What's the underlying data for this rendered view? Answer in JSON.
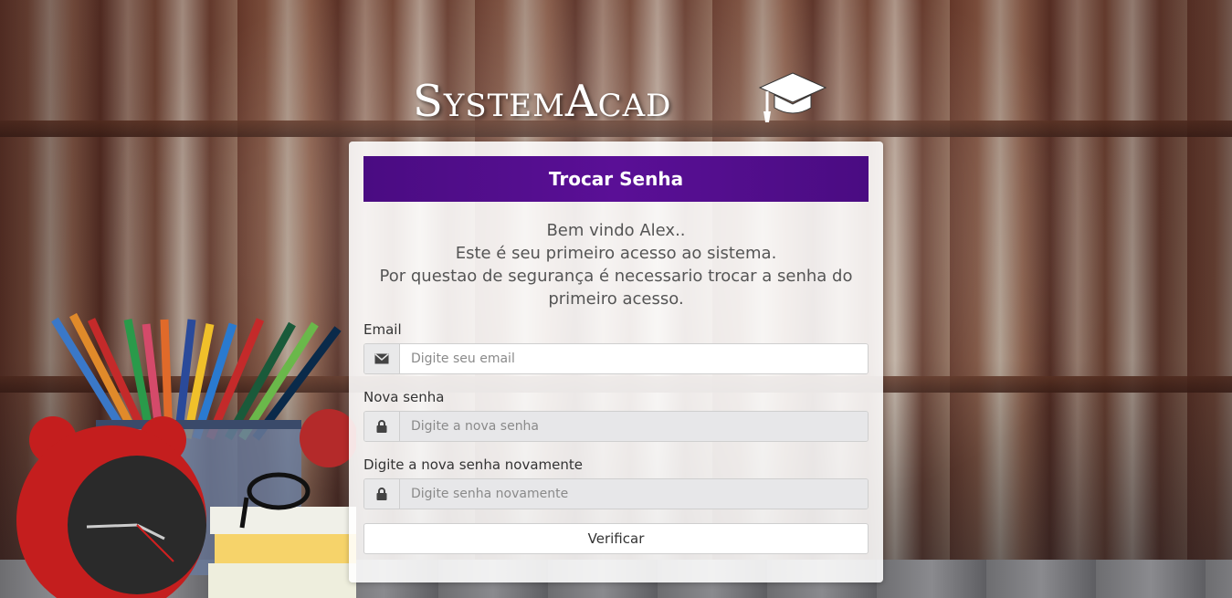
{
  "brand": {
    "name": "SystemAcad",
    "logo_icon": "graduation-cap-icon"
  },
  "card": {
    "title": "Trocar Senha",
    "welcome_lines": [
      "Bem vindo Alex..",
      "Este é seu primeiro acesso ao sistema.",
      "Por questao de segurança é necessario trocar a senha do",
      "primeiro acesso."
    ]
  },
  "form": {
    "email": {
      "label": "Email",
      "placeholder": "Digite seu email",
      "icon": "envelope-icon"
    },
    "new_password": {
      "label": "Nova senha",
      "placeholder": "Digite a nova senha",
      "icon": "lock-icon"
    },
    "confirm_password": {
      "label": "Digite a nova senha novamente",
      "placeholder": "Digite senha novamente",
      "icon": "lock-icon"
    },
    "submit_label": "Verificar"
  },
  "colors": {
    "header_bg": "#4a0c82",
    "header_text": "#ffffff"
  }
}
